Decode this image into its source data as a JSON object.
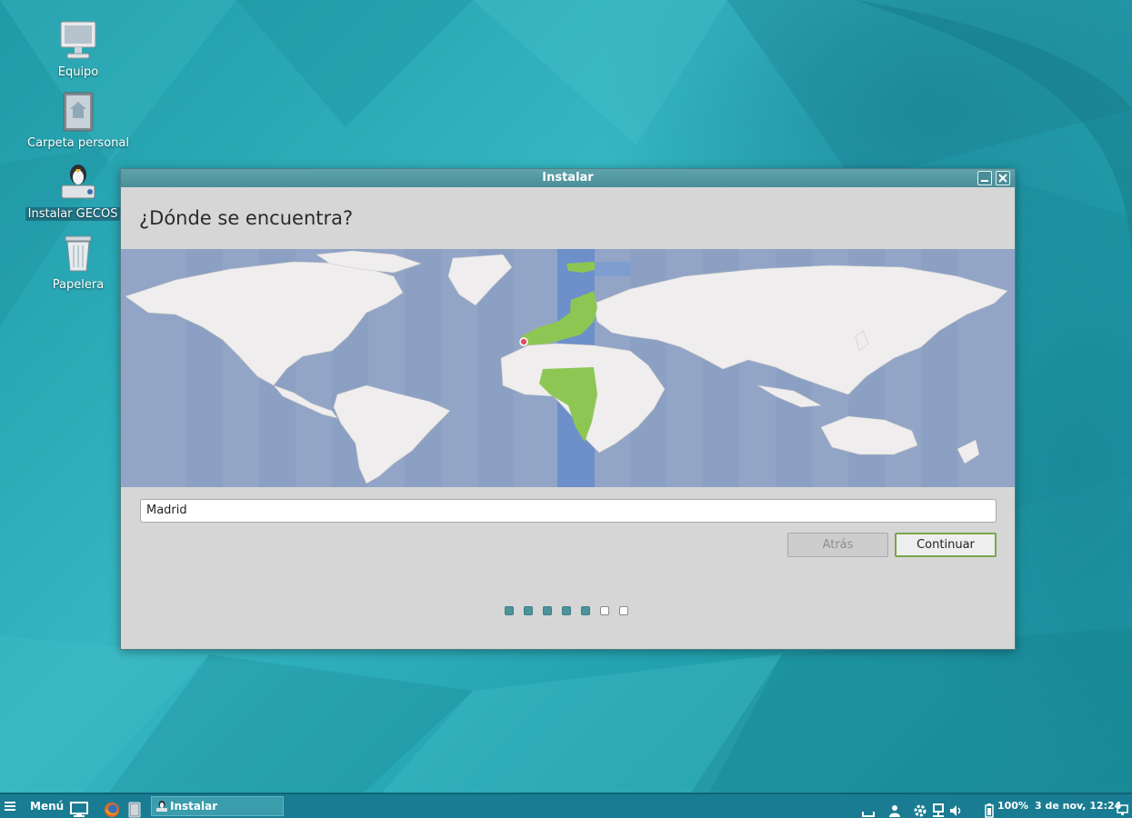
{
  "desktop": {
    "icons": [
      {
        "label": "Equipo",
        "icon": "computer-icon"
      },
      {
        "label": "Carpeta personal",
        "icon": "home-folder-icon"
      },
      {
        "label": "Instalar GECOS v",
        "icon": "installer-icon",
        "selected": true
      },
      {
        "label": "Papelera",
        "icon": "trash-icon"
      }
    ]
  },
  "window": {
    "title": "Instalar",
    "heading": "¿Dónde se encuentra?",
    "city_value": "Madrid",
    "back_label": "Atrás",
    "next_label": "Continuar",
    "progress": {
      "total_steps": 7,
      "completed_steps": 5
    },
    "map_colors": {
      "ocean": "#92a5c7",
      "land": "#efeded",
      "selected_timezone": "#8dc653",
      "timezone_band": "#6d8fca",
      "marker": "#e0505b"
    }
  },
  "taskbar": {
    "menu_label": "Menú",
    "task_label": "Instalar",
    "battery": "100%",
    "clock": "3 de nov, 12:24",
    "icons": [
      "show-desktop-icon",
      "firefox-icon",
      "file-manager-icon",
      "keyboard-icon",
      "user-icon",
      "settings-icon",
      "network-icon",
      "volume-icon",
      "battery-icon",
      "display-icon"
    ]
  },
  "colors": {
    "accent": "#4c939c",
    "desktop": "#2aa7b3",
    "taskbar": "#1a7c92"
  }
}
